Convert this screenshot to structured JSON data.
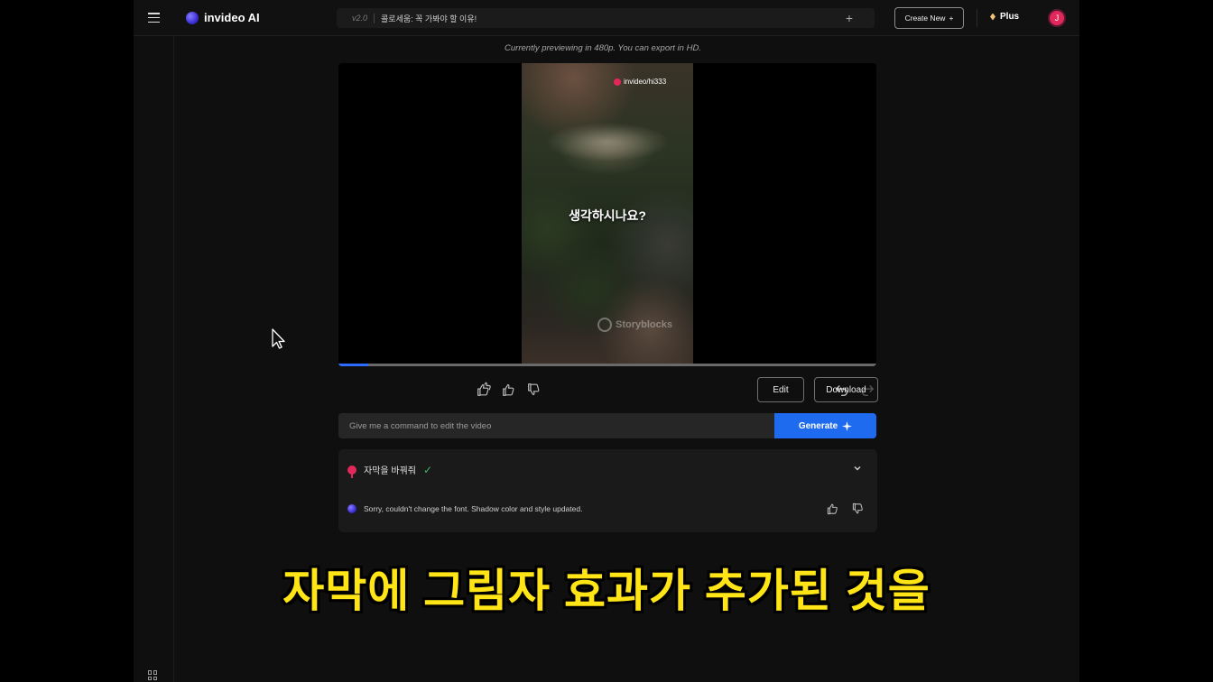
{
  "topbar": {
    "logo_text": "invideo AI",
    "search_version": "v2.0",
    "search_title": "콜로세움: 꼭 가봐야 할 이유!",
    "create_new_label": "Create New",
    "plan_label": "Plus",
    "avatar_initial": "J"
  },
  "preview": {
    "note": "Currently previewing in 480p. You can export in HD.",
    "watermark": "invideo/hi333",
    "caption": "생각하시나요?",
    "stock_watermark": "Storyblocks",
    "progress_fraction": 0.055
  },
  "actions": {
    "edit_label": "Edit",
    "download_label": "Download"
  },
  "command": {
    "placeholder": "Give me a command to edit the video",
    "generate_label": "Generate"
  },
  "history": {
    "user_command": "자막을 바꿔줘",
    "ai_response": "Sorry, couldn't change the font. Shadow color and style updated."
  },
  "overlay_subtitle": "자막에 그림자 효과가 추가된 것을",
  "colors": {
    "accent": "#1f6bf0",
    "avatar": "#e2275a",
    "subtitle": "#ffe516",
    "success": "#3fb86a"
  }
}
